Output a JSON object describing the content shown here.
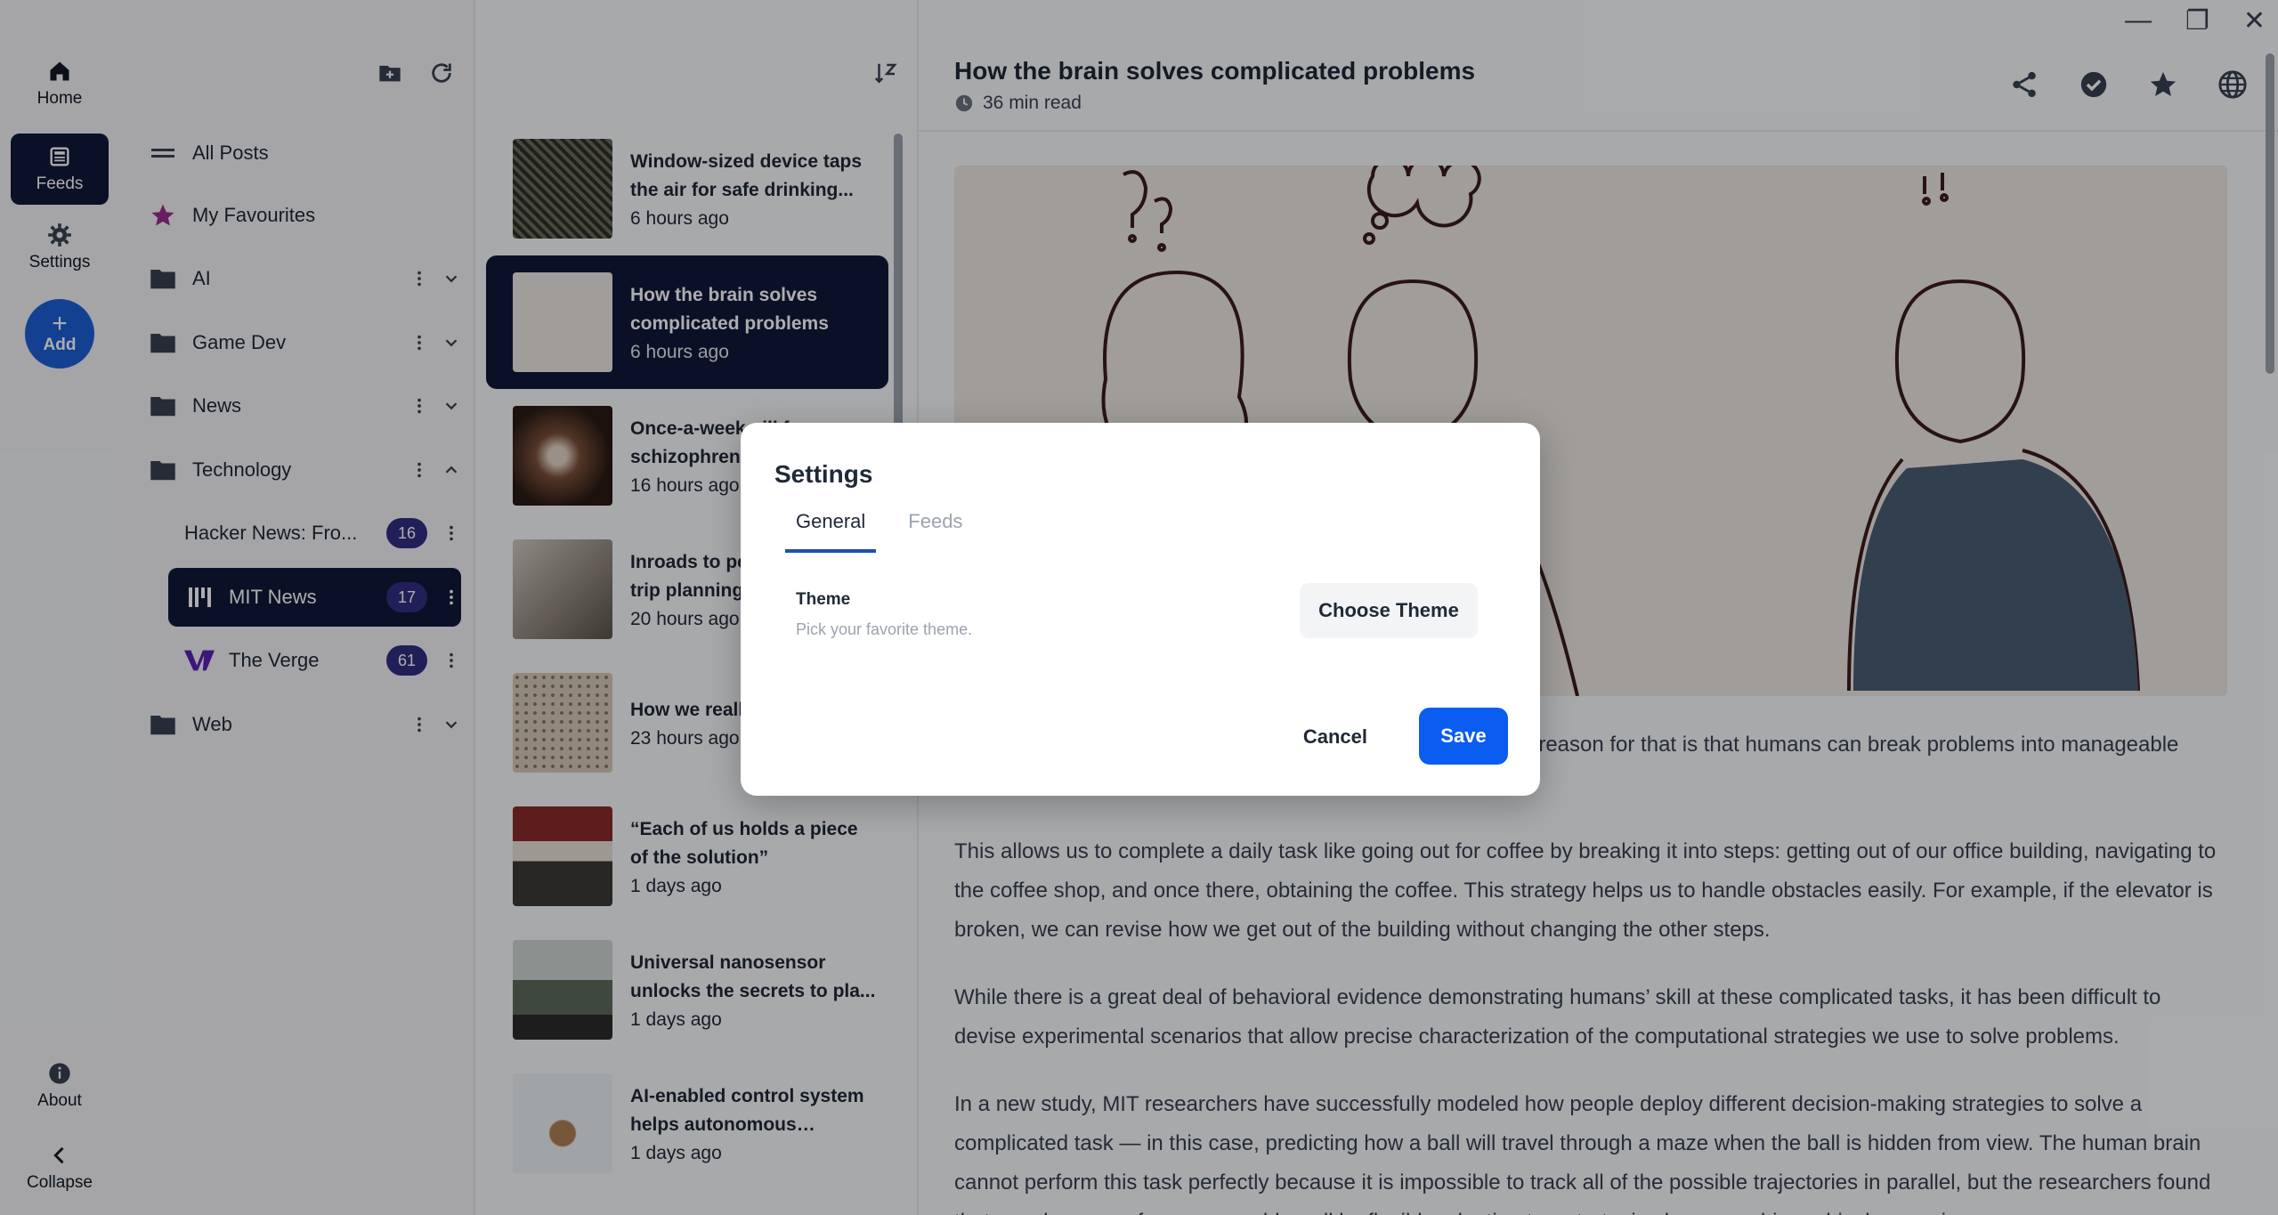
{
  "window_controls": {
    "minimize": "—",
    "restore": "❐",
    "close": "✕"
  },
  "rail": {
    "home_label": "Home",
    "feeds_label": "Feeds",
    "settings_label": "Settings",
    "add_label": "Add",
    "about_label": "About",
    "collapse_label": "Collapse"
  },
  "sidebar": {
    "all_posts": "All Posts",
    "favourites": "My Favourites",
    "folders": [
      {
        "label": "AI"
      },
      {
        "label": "Game Dev"
      },
      {
        "label": "News"
      },
      {
        "label": "Technology"
      },
      {
        "label": "Web"
      }
    ],
    "feeds": [
      {
        "label": "Hacker News: Fro...",
        "count": "16"
      },
      {
        "label": "MIT News",
        "count": "17"
      },
      {
        "label": "The Verge",
        "count": "61"
      }
    ]
  },
  "posts": [
    {
      "title": "Window-sized device taps the air for safe drinking...",
      "time": "6 hours ago"
    },
    {
      "title": "How the brain solves complicated problems",
      "time": "6 hours ago"
    },
    {
      "title": "Once-a-week pill for schizophrenia",
      "time": "16 hours ago"
    },
    {
      "title": "Inroads to personalized AI trip planning",
      "time": "20 hours ago"
    },
    {
      "title": "How we really judge AI",
      "time": "23 hours ago"
    },
    {
      "title": "“Each of us holds a piece of the solution”",
      "time": "1 days ago"
    },
    {
      "title": "Universal nanosensor unlocks the secrets to pla...",
      "time": "1 days ago"
    },
    {
      "title": "AI-enabled control system helps autonomous drones...",
      "time": "1 days ago"
    }
  ],
  "article": {
    "title": "How the brain solves complicated problems",
    "read_time": "36 min read",
    "p1": "Humans are very good at solving complicated problems. One reason for that is that humans can break problems into manageable subtasks that are easy to solve one at a time.",
    "p2": "This allows us to complete a daily task like going out for coffee by breaking it into steps: getting out of our office building, navigating to the coffee shop, and once there, obtaining the coffee. This strategy helps us to handle obstacles easily. For example, if the elevator is broken, we can revise how we get out of the building without changing the other steps.",
    "p3": "While there is a great deal of behavioral evidence demonstrating humans’ skill at these complicated tasks, it has been difficult to devise experimental scenarios that allow precise characterization of the computational strategies we use to solve problems.",
    "p4": "In a new study, MIT researchers have successfully modeled how people deploy different decision-making strategies to solve a complicated task — in this case, predicting how a ball will travel through a maze when the ball is hidden from view. The human brain cannot perform this task perfectly because it is impossible to track all of the possible trajectories in parallel, but the researchers found that people can perform reasonably well by flexibly adopting two strategies known as hierarchical reasoning"
  },
  "dialog": {
    "title": "Settings",
    "tabs": [
      "General",
      "Feeds"
    ],
    "theme_label": "Theme",
    "theme_sub": "Pick your favorite theme.",
    "choose_theme": "Choose Theme",
    "cancel": "Cancel",
    "save": "Save"
  },
  "colors": {
    "accent": "#0b5cf0",
    "active_nav": "#0f1a3a",
    "badge": "#312e81",
    "favourite_star": "#9b2d8f"
  }
}
